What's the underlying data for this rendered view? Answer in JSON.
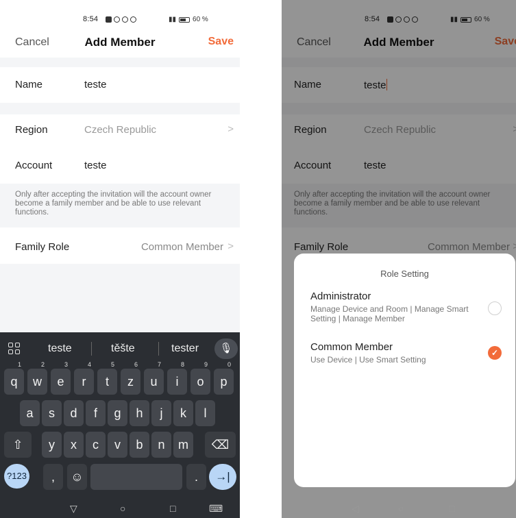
{
  "status": {
    "time": "8:54",
    "battery": "60 %"
  },
  "nav": {
    "cancel": "Cancel",
    "title": "Add Member",
    "save": "Save"
  },
  "form": {
    "name_label": "Name",
    "name_value": "teste",
    "region_label": "Region",
    "region_value": "Czech Republic",
    "account_label": "Account",
    "account_value": "teste",
    "note": "Only after accepting the invitation will the account owner become a family member and be able to use relevant functions.",
    "role_label": "Family Role",
    "role_value": "Common Member"
  },
  "keyboard": {
    "suggestions": [
      "teste",
      "těšte",
      "tester"
    ],
    "row1": [
      {
        "k": "q",
        "h": "1"
      },
      {
        "k": "w",
        "h": "2"
      },
      {
        "k": "e",
        "h": "3"
      },
      {
        "k": "r",
        "h": "4"
      },
      {
        "k": "t",
        "h": "5"
      },
      {
        "k": "z",
        "h": "6"
      },
      {
        "k": "u",
        "h": "7"
      },
      {
        "k": "i",
        "h": "8"
      },
      {
        "k": "o",
        "h": "9"
      },
      {
        "k": "p",
        "h": "0"
      }
    ],
    "row2": [
      "a",
      "s",
      "d",
      "f",
      "g",
      "h",
      "j",
      "k",
      "l"
    ],
    "row3": [
      "y",
      "x",
      "c",
      "v",
      "b",
      "n",
      "m"
    ],
    "num_key": "?123",
    "comma": ",",
    "period": "."
  },
  "role_setting": {
    "title": "Role Setting",
    "options": [
      {
        "title": "Administrator",
        "desc": "Manage Device and Room | Manage Smart Setting | Manage Member",
        "selected": false
      },
      {
        "title": "Common Member",
        "desc": "Use Device | Use Smart Setting",
        "selected": true
      }
    ]
  },
  "colors": {
    "accent": "#f26b3a",
    "keyboard_bg": "#2b2e33",
    "key_bg": "#44474d",
    "action_key": "#b9d6f6"
  },
  "icons": [
    "chevron-right-icon",
    "apps-grid-icon",
    "mic-icon",
    "shift-icon",
    "backspace-icon",
    "emoji-icon",
    "enter-tab-icon",
    "nav-back-icon",
    "nav-home-icon",
    "nav-recents-icon",
    "keyboard-switch-icon",
    "checkmark-icon"
  ]
}
